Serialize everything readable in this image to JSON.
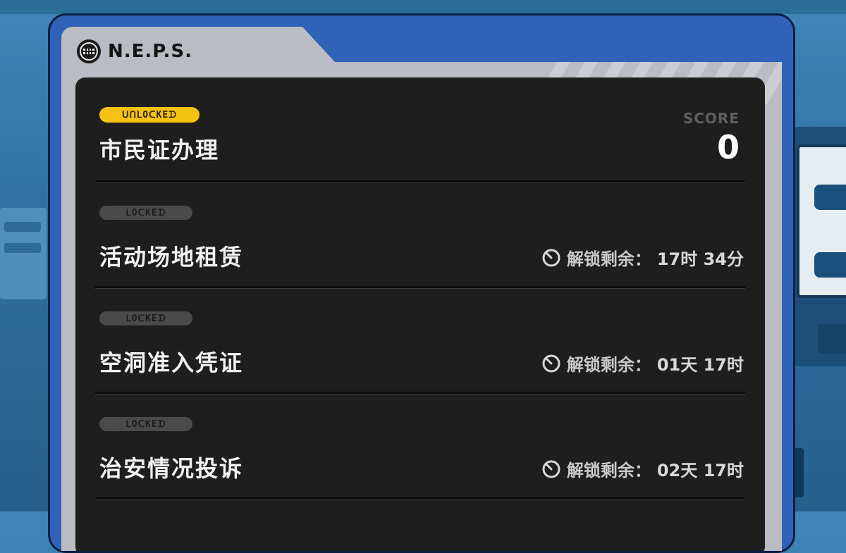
{
  "brand": {
    "name": "N.E.P.S."
  },
  "rows": [
    {
      "tag": "ᑌᑎᒪOᑕKEᗪ",
      "title": "市民证办理",
      "score_label": "SCORE",
      "score": "0"
    },
    {
      "tag": "ᒪOᑕKEᗪ",
      "title": "活动场地租赁",
      "unlock_label": "解锁剩余：",
      "unlock_time": "17时 34分"
    },
    {
      "tag": "ᒪOᑕKEᗪ",
      "title": "空洞准入凭证",
      "unlock_label": "解锁剩余：",
      "unlock_time": "01天 17时"
    },
    {
      "tag": "ᒪOᑕKEᗪ",
      "title": "治安情况投诉",
      "unlock_label": "解锁剩余：",
      "unlock_time": "02天 17时"
    }
  ],
  "colors": {
    "frame": "#2f63b8",
    "panel": "#1e1e1e",
    "accent": "#f5c211",
    "locked_tag": "#444444"
  },
  "icons": {
    "brand": "neps-logo-icon",
    "timer": "clock-icon"
  }
}
